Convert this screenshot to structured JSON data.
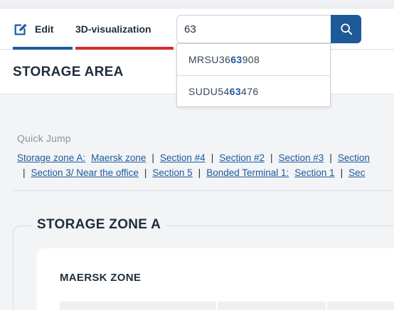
{
  "nav": {
    "tabs": [
      {
        "label": "Edit",
        "underline_color": "#1b5aa0"
      },
      {
        "label": "3D-visualization",
        "underline_color": "#d62b2b"
      }
    ]
  },
  "search": {
    "value": "63",
    "suggestions": [
      {
        "pre": "MRSU36",
        "match": "63",
        "post": "908"
      },
      {
        "pre": "SUDU54",
        "match": "63",
        "post": "476"
      }
    ]
  },
  "page": {
    "title": "STORAGE AREA"
  },
  "quick_jump": {
    "label": "Quick Jump",
    "line1": {
      "zone": "Storage zone A:",
      "links": [
        "Maersk zone",
        "Section #4",
        "Section #2",
        "Section #3",
        "Section"
      ]
    },
    "line2": {
      "links_before": [
        "Section 3/ Near the office",
        "Section 5"
      ],
      "zone": "Bonded Terminal 1:",
      "links_after": [
        "Section 1",
        "Sec"
      ]
    }
  },
  "zone": {
    "title": "STORAGE ZONE A",
    "card_title": "MAERSK ZONE"
  },
  "colors": {
    "primary": "#1d5a97",
    "link": "#1b5aa0",
    "accent_red": "#d62b2b"
  }
}
